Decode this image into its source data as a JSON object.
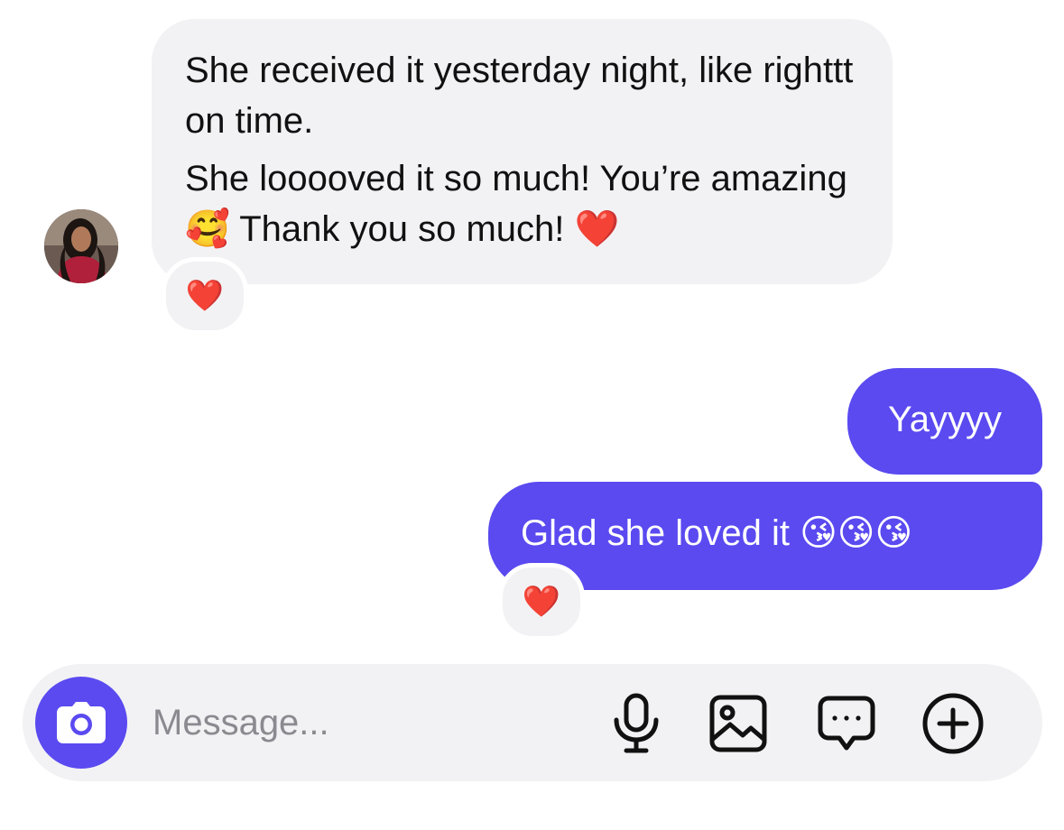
{
  "conversation": {
    "received": {
      "avatar_icon": "contact-avatar",
      "line1": "She received it yesterday night, like righttt on time.",
      "line2": "She looooved it so much! You’re amazing 🥰 Thank you so much! ❤️",
      "reaction": "❤️"
    },
    "sent": [
      {
        "text": "Yayyyy"
      },
      {
        "text": "Glad she loved it 😘😘😘",
        "reaction": "❤️"
      }
    ]
  },
  "composer": {
    "placeholder": "Message...",
    "value": "",
    "icons": [
      "camera-icon",
      "microphone-icon",
      "image-icon",
      "chat-bubble-icon",
      "plus-circle-icon"
    ]
  },
  "colors": {
    "accent": "#5a4af0",
    "bubble_received": "#f2f2f4",
    "reaction_heart": "#e8132a"
  }
}
